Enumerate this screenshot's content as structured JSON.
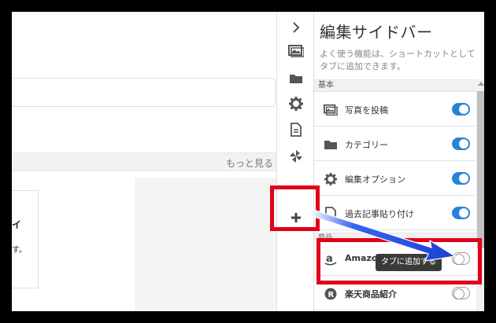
{
  "editor": {
    "more_link": "もっと見る",
    "card_text_1": "イ",
    "card_text_2": "す。"
  },
  "icon_strip": {
    "icons": [
      "chevron-right-icon",
      "image-icon",
      "folder-icon",
      "gear-icon",
      "document-icon",
      "pinwheel-icon",
      "plus-icon"
    ]
  },
  "sidebar": {
    "title": "編集サイドバー",
    "description": "よく使う機能は、ショートカットとしてタブに追加できます。",
    "section_basic": "基本",
    "section_other": "商品",
    "items": [
      {
        "label": "写真を投稿",
        "icon": "image-icon",
        "enabled": true
      },
      {
        "label": "カテゴリー",
        "icon": "folder-icon",
        "enabled": true
      },
      {
        "label": "編集オプション",
        "icon": "gear-icon",
        "enabled": true
      },
      {
        "label": "過去記事貼り付け",
        "icon": "document-icon",
        "enabled": true
      },
      {
        "label": "Amazon",
        "icon": "amazon-icon",
        "enabled": false
      },
      {
        "label": "楽天商品紹介",
        "icon": "rakuten-icon",
        "enabled": false
      }
    ],
    "tooltip": "タブに追加する"
  },
  "colors": {
    "toggle_on": "#2684d8",
    "highlight_red": "#e0001a",
    "arrow_blue": "#1a3fd6"
  }
}
